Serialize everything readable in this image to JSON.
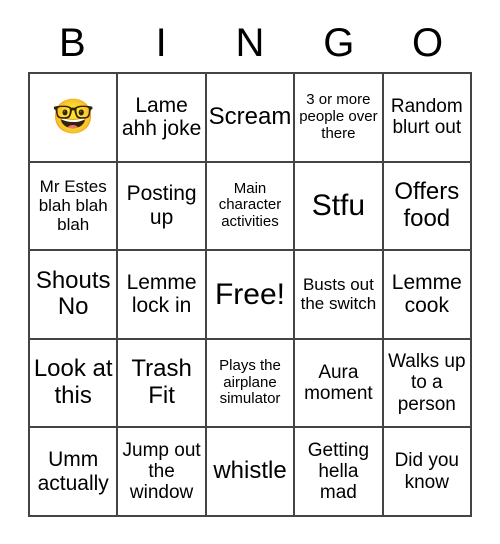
{
  "card": {
    "header_letters": [
      "B",
      "I",
      "N",
      "G",
      "O"
    ],
    "rows": [
      [
        {
          "text": "🤓",
          "kind": "emoji",
          "size": "emoji",
          "name": "nerd-face-emoji"
        },
        {
          "text": "Lame ahh joke",
          "kind": "text",
          "size": "fs-l",
          "name": "bingo-cell"
        },
        {
          "text": "Scream",
          "kind": "text",
          "size": "fs-xl",
          "name": "bingo-cell"
        },
        {
          "text": "3 or more people over there",
          "kind": "text",
          "size": "fs-xs",
          "name": "bingo-cell"
        },
        {
          "text": "Random blurt out",
          "kind": "text",
          "size": "fs-m",
          "name": "bingo-cell"
        }
      ],
      [
        {
          "text": "Mr Estes blah blah blah",
          "kind": "text",
          "size": "fs-s",
          "name": "bingo-cell"
        },
        {
          "text": "Posting up",
          "kind": "text",
          "size": "fs-l",
          "name": "bingo-cell"
        },
        {
          "text": "Main character activities",
          "kind": "text",
          "size": "fs-xs",
          "name": "bingo-cell"
        },
        {
          "text": "Stfu",
          "kind": "text",
          "size": "fs-xxl",
          "name": "bingo-cell"
        },
        {
          "text": "Offers food",
          "kind": "text",
          "size": "fs-xl",
          "name": "bingo-cell"
        }
      ],
      [
        {
          "text": "Shouts No",
          "kind": "text",
          "size": "fs-xl",
          "name": "bingo-cell"
        },
        {
          "text": "Lemme lock in",
          "kind": "text",
          "size": "fs-l",
          "name": "bingo-cell"
        },
        {
          "text": "Free!",
          "kind": "text",
          "size": "fs-xxl",
          "name": "bingo-free-cell"
        },
        {
          "text": "Busts out the switch",
          "kind": "text",
          "size": "fs-s",
          "name": "bingo-cell"
        },
        {
          "text": "Lemme cook",
          "kind": "text",
          "size": "fs-l",
          "name": "bingo-cell"
        }
      ],
      [
        {
          "text": "Look at this",
          "kind": "text",
          "size": "fs-xl",
          "name": "bingo-cell"
        },
        {
          "text": "Trash Fit",
          "kind": "text",
          "size": "fs-xl",
          "name": "bingo-cell"
        },
        {
          "text": "Plays the airplane simulator",
          "kind": "text",
          "size": "fs-xs",
          "name": "bingo-cell"
        },
        {
          "text": "Aura moment",
          "kind": "text",
          "size": "fs-m",
          "name": "bingo-cell"
        },
        {
          "text": "Walks up to a person",
          "kind": "text",
          "size": "fs-m",
          "name": "bingo-cell"
        }
      ],
      [
        {
          "text": "Umm actually",
          "kind": "text",
          "size": "fs-l",
          "name": "bingo-cell"
        },
        {
          "text": "Jump out the window",
          "kind": "text",
          "size": "fs-m",
          "name": "bingo-cell"
        },
        {
          "text": "whistle",
          "kind": "text",
          "size": "fs-xl",
          "name": "bingo-cell"
        },
        {
          "text": "Getting hella mad",
          "kind": "text",
          "size": "fs-m",
          "name": "bingo-cell"
        },
        {
          "text": "Did you know",
          "kind": "text",
          "size": "fs-m",
          "name": "bingo-cell"
        }
      ]
    ],
    "colors": {
      "border": "#444444",
      "background": "#ffffff",
      "text": "#000000"
    }
  }
}
